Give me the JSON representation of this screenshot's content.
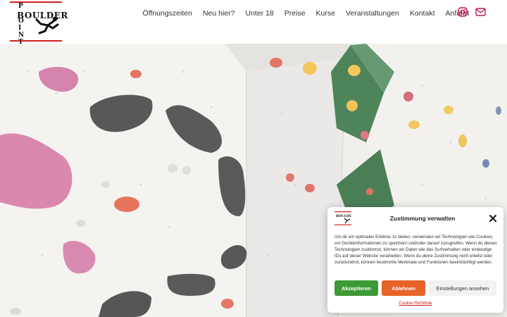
{
  "logo": {
    "word": "BOULDER",
    "vertical_letters": [
      "P",
      "O",
      "I",
      "N",
      "T"
    ],
    "accent_color": "#d21f1f"
  },
  "nav": {
    "items": [
      {
        "label": "Öffnungszeiten"
      },
      {
        "label": "Neu hier?"
      },
      {
        "label": "Unter 18"
      },
      {
        "label": "Preise"
      },
      {
        "label": "Kurse"
      },
      {
        "label": "Veranstaltungen"
      },
      {
        "label": "Kontakt"
      },
      {
        "label": "Anfahrt"
      }
    ]
  },
  "social": {
    "instagram_icon": "instagram-icon",
    "mail_icon": "mail-icon",
    "color": "#c2185b"
  },
  "hero": {
    "description_icon": "climbing-wall-photo"
  },
  "consent": {
    "title": "Zustimmung verwalten",
    "text": "Um dir ein optimales Erlebnis zu bieten, verwenden wir Technologien wie Cookies, um Geräteinformationen zu speichern und/oder darauf zuzugreifen. Wenn du diesen Technologien zustimmst, können wir Daten wie das Surfverhalten oder eindeutige IDs auf dieser Website verarbeiten. Wenn du deine Zustimmung nicht erteilst oder zurückziehst, können bestimmte Merkmale und Funktionen beeinträchtigt werden.",
    "accept_label": "Akzeptieren",
    "deny_label": "Ablehnen",
    "settings_label": "Einstellungen ansehen",
    "link_label": "Cookie-Richtlinie",
    "accept_color": "#3d9a36",
    "deny_color": "#e8632a"
  }
}
